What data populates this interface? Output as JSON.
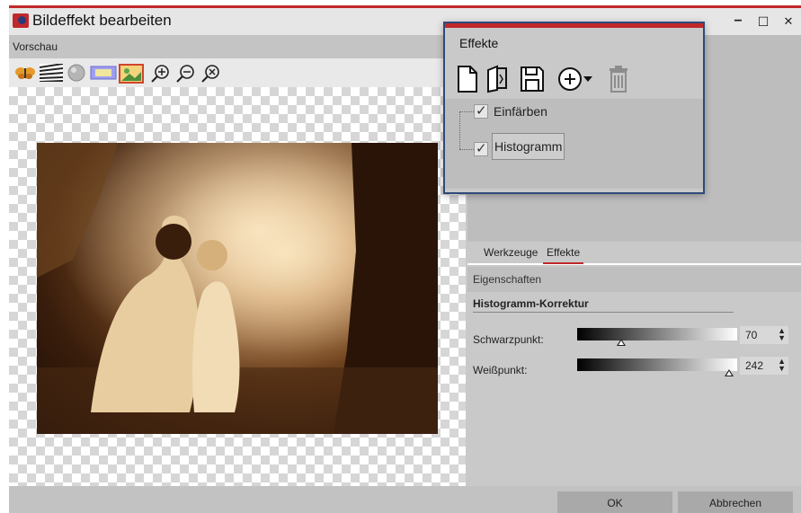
{
  "window": {
    "title": "Bildeffekt bearbeiten",
    "controls": {
      "minimize": "−",
      "maximize": "☐",
      "close": "✕"
    }
  },
  "preview": {
    "header": "Vorschau",
    "toolbar_icons": [
      "butterfly-icon",
      "zebra-icon",
      "sphere-icon",
      "frame-icon",
      "photo-icon",
      "zoom-in-icon",
      "zoom-out-icon",
      "zoom-fit-icon"
    ]
  },
  "popup": {
    "title": "Effekte",
    "tools": [
      "new-file-icon",
      "open-file-icon",
      "save-icon",
      "add-dropdown-icon",
      "delete-icon"
    ],
    "effects": [
      {
        "label": "Einfärben",
        "checked": true
      },
      {
        "label": "Histogramm",
        "checked": true,
        "selected": true
      }
    ]
  },
  "tabs": [
    {
      "label": "Werkzeuge",
      "active": false
    },
    {
      "label": "Effekte",
      "active": true
    }
  ],
  "properties": {
    "header": "Eigenschaften",
    "section_title": "Histogramm-Korrektur",
    "params": [
      {
        "label": "Schwarzpunkt:",
        "value": "70",
        "level": 70,
        "max": 255
      },
      {
        "label": "Weißpunkt:",
        "value": "242",
        "level": 242,
        "max": 255
      }
    ]
  },
  "footer": {
    "ok_label": "OK",
    "cancel_label": "Abbrechen"
  },
  "colors": {
    "accent": "#c0282a",
    "popup_border": "#2e4a7a"
  }
}
